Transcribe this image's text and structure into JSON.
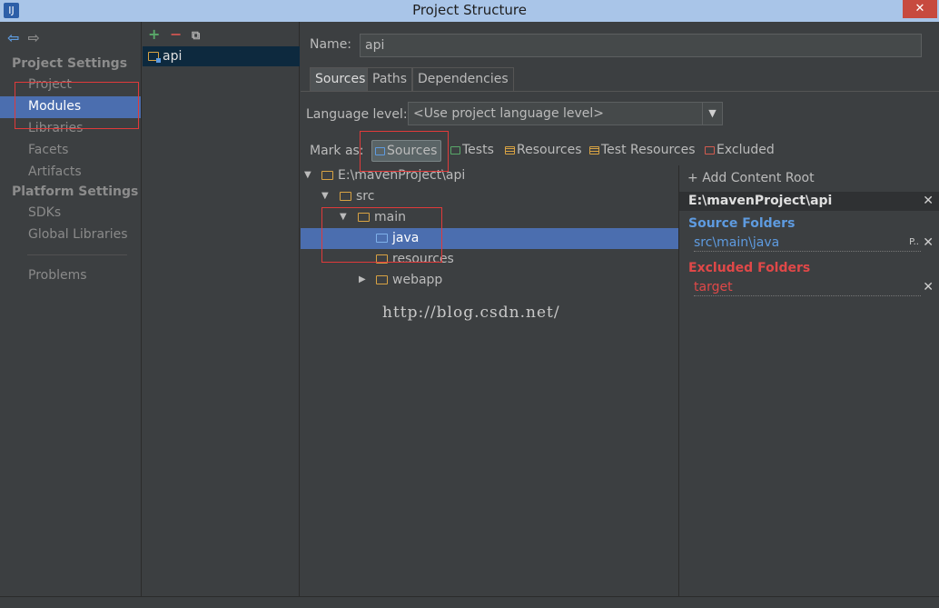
{
  "window": {
    "title": "Project Structure",
    "app_icon": "IJ",
    "close_glyph": "✕"
  },
  "nav": {
    "back": "⇦",
    "forward": "⇨"
  },
  "left_panel": {
    "project_settings_title": "Project Settings",
    "project_items": [
      "Project",
      "Modules",
      "Libraries",
      "Facets",
      "Artifacts"
    ],
    "platform_settings_title": "Platform Settings",
    "platform_items": [
      "SDKs",
      "Global Libraries"
    ],
    "other_items": [
      "Problems"
    ],
    "selected": "Modules"
  },
  "module_panel": {
    "add": "+",
    "remove": "−",
    "copy": "⧉",
    "modules": [
      "api"
    ]
  },
  "main": {
    "name_label": "Name:",
    "name_value": "api",
    "tabs": [
      "Sources",
      "Paths",
      "Dependencies"
    ],
    "active_tab": "Sources",
    "language_level_label": "Language level:",
    "language_level_value": "<Use project language level>",
    "mark_as_label": "Mark as:",
    "mark_as": [
      "Sources",
      "Tests",
      "Resources",
      "Test Resources",
      "Excluded"
    ],
    "tree": {
      "root": "E:\\mavenProject\\api",
      "src": "src",
      "main": "main",
      "java": "java",
      "resources": "resources",
      "webapp": "webapp"
    },
    "watermark": "http://blog.csdn.net/"
  },
  "content_root": {
    "add_label": "Add Content Root",
    "root_path": "E:\\mavenProject\\api",
    "source_folders_title": "Source Folders",
    "source_folders": [
      "src\\main\\java"
    ],
    "excluded_folders_title": "Excluded Folders",
    "excluded_folders": [
      "target"
    ],
    "source_color": "#5e9be0",
    "excluded_color": "#e04848",
    "props_glyph": "P..",
    "remove_glyph": "✕"
  }
}
